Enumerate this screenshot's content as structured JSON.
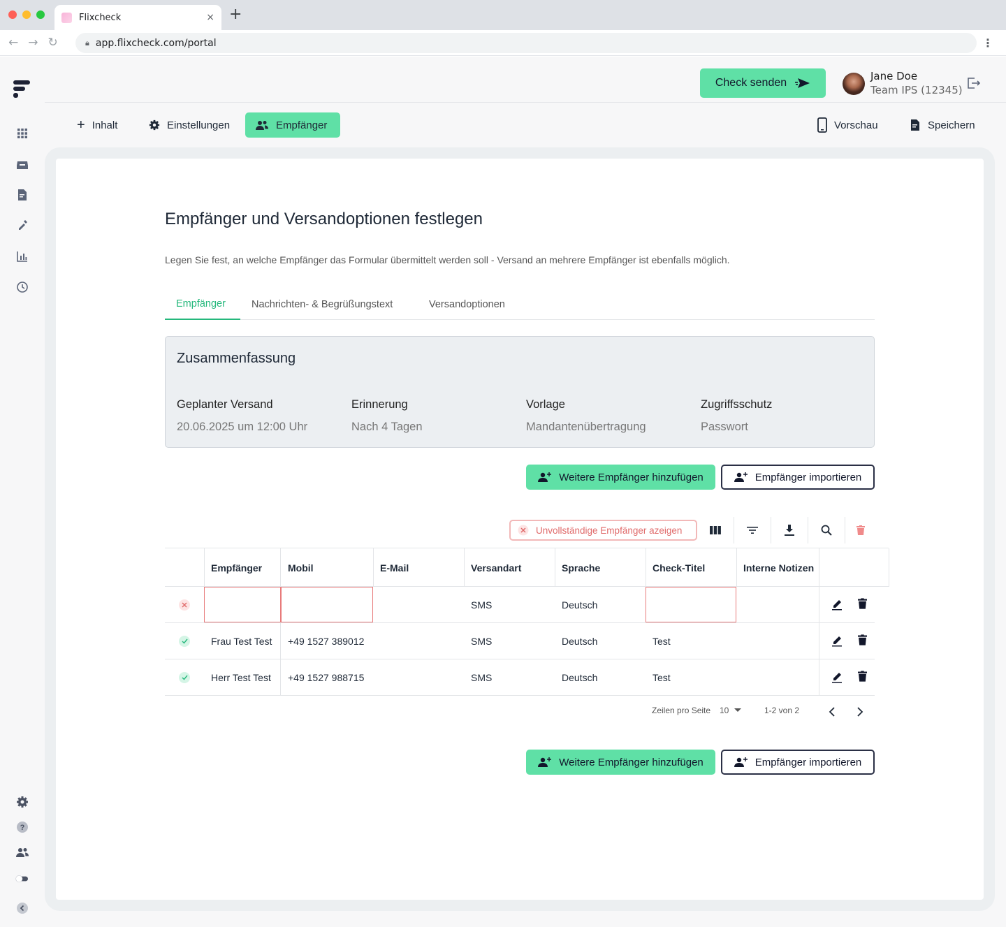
{
  "browser": {
    "tab_title": "Flixcheck",
    "tab_close": "×",
    "new_tab": "+",
    "url": "app.flixcheck.com/portal"
  },
  "header": {
    "check_button": "Check senden",
    "user_name": "Jane Doe",
    "user_team": "Team IPS (12345)"
  },
  "toolbar": {
    "inhalt": "Inhalt",
    "einstellungen": "Einstellungen",
    "empfaenger": "Empfänger",
    "vorschau": "Vorschau",
    "speichern": "Speichern"
  },
  "main": {
    "title": "Empfänger und Versandoptionen festlegen",
    "lead": "Legen Sie fest, an welche Empfänger das Formular übermittelt werden soll - Versand an mehrere Empfänger ist ebenfalls möglich.",
    "tabs": [
      "Empfänger",
      "Nachrichten- & Begrüßungstext",
      "Versandoptionen"
    ],
    "active_tab": "Empfänger"
  },
  "summary": {
    "title": "Zusammenfassung",
    "items": [
      {
        "label": "Geplanter Versand",
        "value": "20.06.2025 um 12:00 Uhr"
      },
      {
        "label": "Erinnerung",
        "value": "Nach 4 Tagen"
      },
      {
        "label": "Vorlage",
        "value": "Mandantenübertragung"
      },
      {
        "label": "Zugriffsschutz",
        "value": "Passwort"
      }
    ]
  },
  "actions": {
    "add_label": "Weitere Empfänger hinzufügen",
    "import_label": "Empfänger importieren"
  },
  "table_toolbar": {
    "incomplete_label": "Unvollständige Empfänger azeigen",
    "icons": [
      "columns-icon",
      "filter-icon",
      "download-icon",
      "search-icon",
      "delete-icon"
    ]
  },
  "table": {
    "columns": [
      "Empfänger",
      "Mobil",
      "E-Mail",
      "Versandart",
      "Sprache",
      "Check-Titel",
      "Interne Notizen"
    ],
    "rows": [
      {
        "status": "error",
        "empfaenger": "",
        "mobil": "",
        "email": "",
        "versandart": "SMS",
        "sprache": "Deutsch",
        "titel": "",
        "notizen": ""
      },
      {
        "status": "ok",
        "empfaenger": "Frau Test Test",
        "mobil": "+49 1527 389012",
        "email": "",
        "versandart": "SMS",
        "sprache": "Deutsch",
        "titel": "Test",
        "notizen": ""
      },
      {
        "status": "ok",
        "empfaenger": "Herr Test Test",
        "mobil": "+49 1527 988715",
        "email": "",
        "versandart": "SMS",
        "sprache": "Deutsch",
        "titel": "Test",
        "notizen": ""
      }
    ]
  },
  "pagination": {
    "rows_label": "Zeilen pro Seite",
    "rows_value": "10",
    "range": "1-2 von 2"
  },
  "colors": {
    "accent": "#5fe0a6",
    "accent_text": "#25b87c",
    "error": "#e87b7b",
    "dark": "#1e2235"
  }
}
